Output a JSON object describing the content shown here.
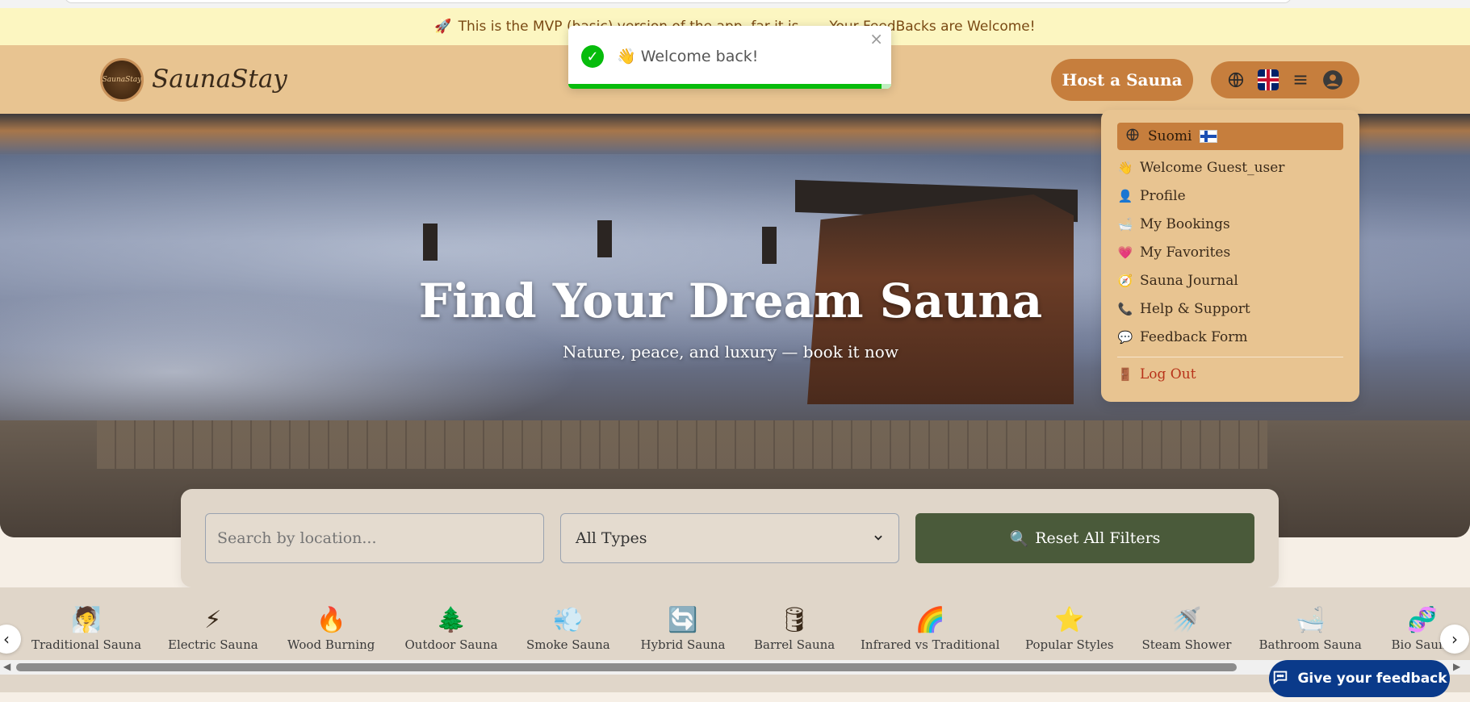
{
  "banner": {
    "rocket_icon": "rocket-icon",
    "text": "This is the MVP (basic) version of the app, far it is ... , Your FeedBacks are Welcome!"
  },
  "header": {
    "brand": "SaunaStay",
    "logo_text": "SaunaStay",
    "host_label": "Host a Sauna",
    "user_menu": {
      "icons": [
        "globe-icon",
        "uk-flag-icon",
        "menu-icon",
        "user-circle-icon"
      ]
    }
  },
  "toast": {
    "message": "👋 Welcome back!",
    "close": "×",
    "progress": 0.97
  },
  "hero": {
    "title": "Find Your Dream Sauna",
    "subtitle": "Nature, peace, and luxury — book it now"
  },
  "search": {
    "placeholder": "Search by location...",
    "type_value": "All Types",
    "reset_label": "Reset All Filters",
    "reset_icon": "🔍"
  },
  "categories": [
    {
      "icon": "🧖",
      "label": "Traditional Sauna",
      "name": "traditional"
    },
    {
      "icon": "⚡",
      "label": "Electric Sauna",
      "name": "electric"
    },
    {
      "icon": "🔥",
      "label": "Wood Burning",
      "name": "wood-burning"
    },
    {
      "icon": "🌲",
      "label": "Outdoor Sauna",
      "name": "outdoor"
    },
    {
      "icon": "💨",
      "label": "Smoke Sauna",
      "name": "smoke"
    },
    {
      "icon": "🔄",
      "label": "Hybrid Sauna",
      "name": "hybrid"
    },
    {
      "icon": "🛢",
      "label": "Barrel Sauna",
      "name": "barrel"
    },
    {
      "icon": "🌈",
      "label": "Infrared vs Traditional",
      "name": "infrared"
    },
    {
      "icon": "⭐",
      "label": "Popular Styles",
      "name": "popular"
    },
    {
      "icon": "🚿",
      "label": "Steam Shower",
      "name": "steam"
    },
    {
      "icon": "🛁",
      "label": "Bathroom Sauna",
      "name": "bathroom"
    },
    {
      "icon": "🧬",
      "label": "Bio Sauna",
      "name": "bio"
    }
  ],
  "menu": {
    "language": "Suomi",
    "items": [
      {
        "icon": "👋",
        "label": "Welcome Guest_user",
        "name": "welcome"
      },
      {
        "icon": "👤",
        "label": "Profile",
        "name": "profile"
      },
      {
        "icon": "🛁",
        "label": "My Bookings",
        "name": "bookings"
      },
      {
        "icon": "💗",
        "label": "My Favorites",
        "name": "favorites"
      },
      {
        "icon": "🧭",
        "label": "Sauna Journal",
        "name": "journal"
      },
      {
        "icon": "📞",
        "label": "Help & Support",
        "name": "help"
      },
      {
        "icon": "💬",
        "label": "Feedback Form",
        "name": "feedback"
      }
    ],
    "logout": {
      "icon": "🚪",
      "label": "Log Out"
    }
  },
  "feedback_button": {
    "label": "Give your feedback",
    "icon": "chat-icon"
  }
}
